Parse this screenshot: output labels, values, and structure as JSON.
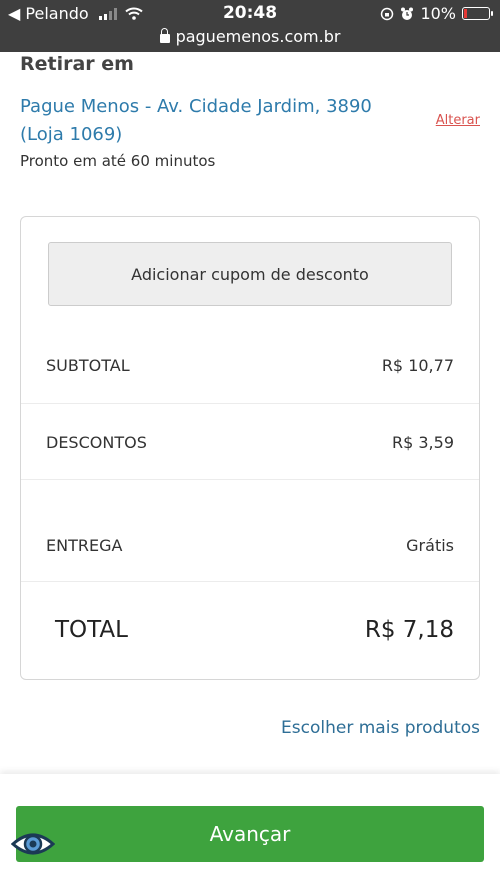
{
  "status_bar": {
    "back_label": "◀ Pelando",
    "time": "20:48",
    "battery": "10%",
    "url": "paguemenos.com.br"
  },
  "pickup": {
    "title": "Retirar em",
    "store": "Pague Menos - Av. Cidade Jardim, 3890 (Loja 1069)",
    "change_label": "Alterar",
    "ready_time": "Pronto em até 60 minutos"
  },
  "summary": {
    "coupon_button": "Adicionar cupom de desconto",
    "subtotal_label": "SUBTOTAL",
    "subtotal_value": "R$ 10,77",
    "discount_label": "DESCONTOS",
    "discount_value": "R$ 3,59",
    "delivery_label": "ENTREGA",
    "delivery_value": "Grátis",
    "total_label": "TOTAL",
    "total_value": "R$ 7,18"
  },
  "more_products": "Escolher mais produtos",
  "advance_button": "Avançar",
  "colors": {
    "link_blue": "#2e7bab",
    "alter_red": "#d9534f",
    "button_green": "#3ea33e",
    "status_bar": "#3f3f3f"
  }
}
